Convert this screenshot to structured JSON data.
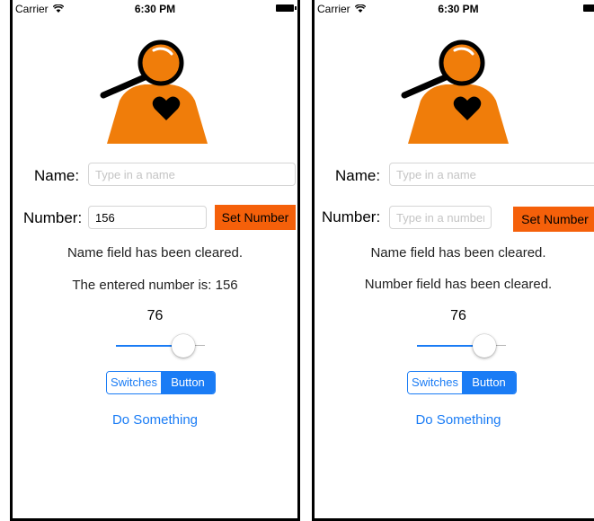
{
  "screens": [
    {
      "status": {
        "carrier": "Carrier",
        "time": "6:30 PM"
      },
      "name_label": "Name:",
      "name_placeholder": "Type in a name",
      "name_value": "",
      "number_label": "Number:",
      "number_placeholder": "Type in a number",
      "number_value": "156",
      "set_button": "Set Number",
      "message1": "Name field has been cleared.",
      "message2": "The entered number is: 156",
      "slider_value_text": "76",
      "slider_fraction": 0.76,
      "segments": [
        "Switches",
        "Button"
      ],
      "selected_segment": 1,
      "do_something": "Do Something"
    },
    {
      "status": {
        "carrier": "Carrier",
        "time": "6:30 PM"
      },
      "name_label": "Name:",
      "name_placeholder": "Type in a name",
      "name_value": "",
      "number_label": "Number:",
      "number_placeholder": "Type in a number",
      "number_value": "",
      "set_button": "Set Number",
      "message1": "Name field has been cleared.",
      "message2": "Number field has been cleared.",
      "slider_value_text": "76",
      "slider_fraction": 0.76,
      "segments": [
        "Switches",
        "Button"
      ],
      "selected_segment": 1,
      "do_something": "Do Something"
    }
  ],
  "icons": [
    "wifi-icon",
    "battery-icon",
    "magnifier-person-logo-icon",
    "heart-icon"
  ],
  "colors": {
    "accent": "#1a7cf5",
    "orange": "#f5600a",
    "logo_orange": "#f07d0a"
  }
}
